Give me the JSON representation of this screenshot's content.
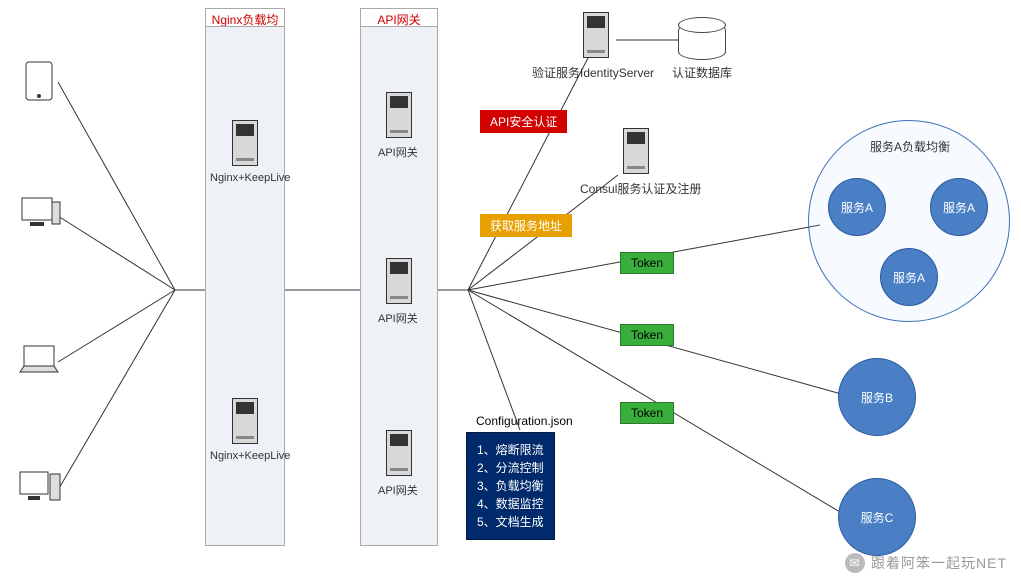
{
  "columns": {
    "nginx": {
      "title": "Nginx负载均衡"
    },
    "api": {
      "title": "API网关"
    }
  },
  "nginx_nodes": [
    {
      "label": "Nginx+KeepLive"
    },
    {
      "label": "Nginx+KeepLive"
    }
  ],
  "api_nodes": [
    {
      "label": "API网关"
    },
    {
      "label": "API网关"
    },
    {
      "label": "API网关"
    }
  ],
  "identity": {
    "label": "验证服务IdentityServer"
  },
  "auth_db": {
    "label": "认证数据库"
  },
  "consul": {
    "label": "Consul服务认证及注册"
  },
  "badges": {
    "api_secure": "API安全认证",
    "get_addr": "获取服务地址",
    "token": "Token"
  },
  "config": {
    "title": "Configuration.json",
    "lines": "1、熔断限流\n2、分流控制\n3、负载均衡\n4、数据监控\n5、文档生成"
  },
  "serviceA_group": {
    "title": "服务A负载均衡",
    "node_label": "服务A"
  },
  "serviceB": {
    "label": "服务B"
  },
  "serviceC": {
    "label": "服务C"
  },
  "watermark": {
    "text": "跟着阿笨一起玩NET"
  }
}
